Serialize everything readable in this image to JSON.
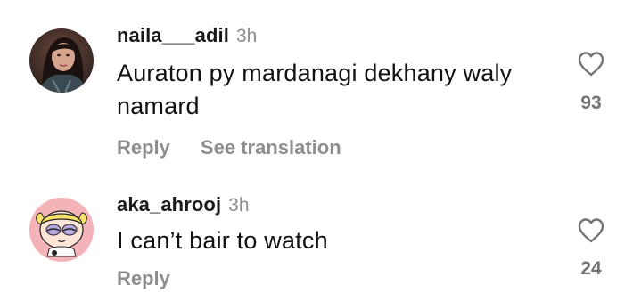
{
  "comments": [
    {
      "username": "naila___adil",
      "time": "3h",
      "text": "Auraton py mardanagi dekhany waly namard",
      "reply_label": "Reply",
      "translation_label": "See translation",
      "likes": "93"
    },
    {
      "username": "aka_ahrooj",
      "time": "3h",
      "text": "I can’t bair to watch",
      "reply_label": "Reply",
      "likes": "24"
    }
  ],
  "colors": {
    "secondary_text": "#8e8e8e",
    "primary_text": "#121212",
    "avatar2_bg": "#f4b3b8"
  },
  "icons": [
    "heart-icon"
  ]
}
